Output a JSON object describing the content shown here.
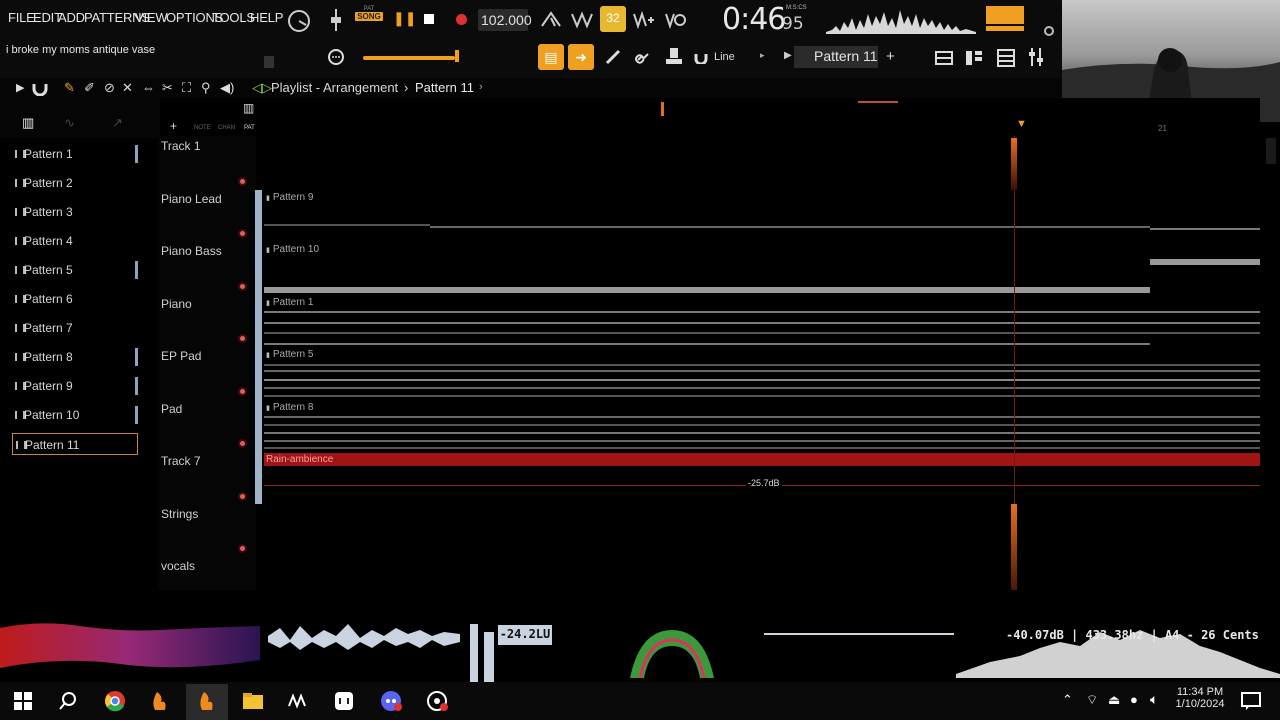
{
  "menu": [
    "FILE",
    "EDIT",
    "ADD",
    "PATTERNS",
    "VIEW",
    "OPTIONS",
    "TOOLS",
    "HELP"
  ],
  "transport": {
    "mode_top": "PAT",
    "mode_bottom": "SONG",
    "tempo": "102.000",
    "counter": "32",
    "time_main": "0:46",
    "time_sub": "95",
    "time_unit": "M:S:CS"
  },
  "hint": "i broke my moms antique vase",
  "toolbar": {
    "snap": "Line",
    "pattern": "Pattern 11",
    "add": "+"
  },
  "playlist": {
    "title": "Playlist - Arrangement",
    "separator": "›",
    "pattern": "Pattern 11",
    "bar_marker": "21",
    "db_readout": "-25.7dB"
  },
  "picker_tabs": [
    "NOTE",
    "CHAN",
    "PAT"
  ],
  "patterns": [
    "Pattern 1",
    "Pattern 2",
    "Pattern 3",
    "Pattern 4",
    "Pattern 5",
    "Pattern 6",
    "Pattern 7",
    "Pattern 8",
    "Pattern 9",
    "Pattern 10",
    "Pattern 11"
  ],
  "tracks": [
    "Track 1",
    "Piano Lead",
    "Piano Bass",
    "Piano",
    "EP Pad",
    "Pad",
    "Track 7",
    "Strings",
    "vocals"
  ],
  "clips": [
    "Pattern 9",
    "Pattern 10",
    "Pattern 1",
    "Pattern 5",
    "Pattern 8",
    "Rain-ambience"
  ],
  "meters": {
    "loudness": "-24.2LU",
    "tuner": "-40.07dB | 433.38hz | A4 - 26 Cents"
  },
  "taskbar": {
    "time": "11:34 PM",
    "date": "1/10/2024"
  },
  "colors": {
    "accent": "#f0a020",
    "clip_audio": "#c01818",
    "track_marker": "#e35c5c"
  }
}
